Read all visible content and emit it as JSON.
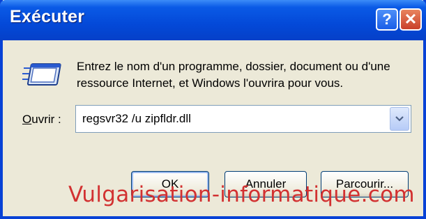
{
  "window": {
    "title": "Exécuter"
  },
  "titlebar": {
    "help_glyph": "?",
    "close_glyph": "✕"
  },
  "body": {
    "icon": "run-icon",
    "description": "Entrez le nom d'un programme, dossier, document ou d'une ressource Internet, et Windows l'ouvrira pour vous."
  },
  "open": {
    "label_mnemonic": "O",
    "label_rest": "uvrir :",
    "value": "regsvr32 /u zipfldr.dll"
  },
  "buttons": {
    "ok": "OK",
    "cancel": "Annuler",
    "browse": "Parcourir..."
  },
  "watermark": "Vulgarisation-informatique.com",
  "colors": {
    "titlebar": "#0449d8",
    "frame": "#0842d6",
    "close": "#c9402a",
    "watermark": "#d23131",
    "face": "#ece9d8"
  }
}
